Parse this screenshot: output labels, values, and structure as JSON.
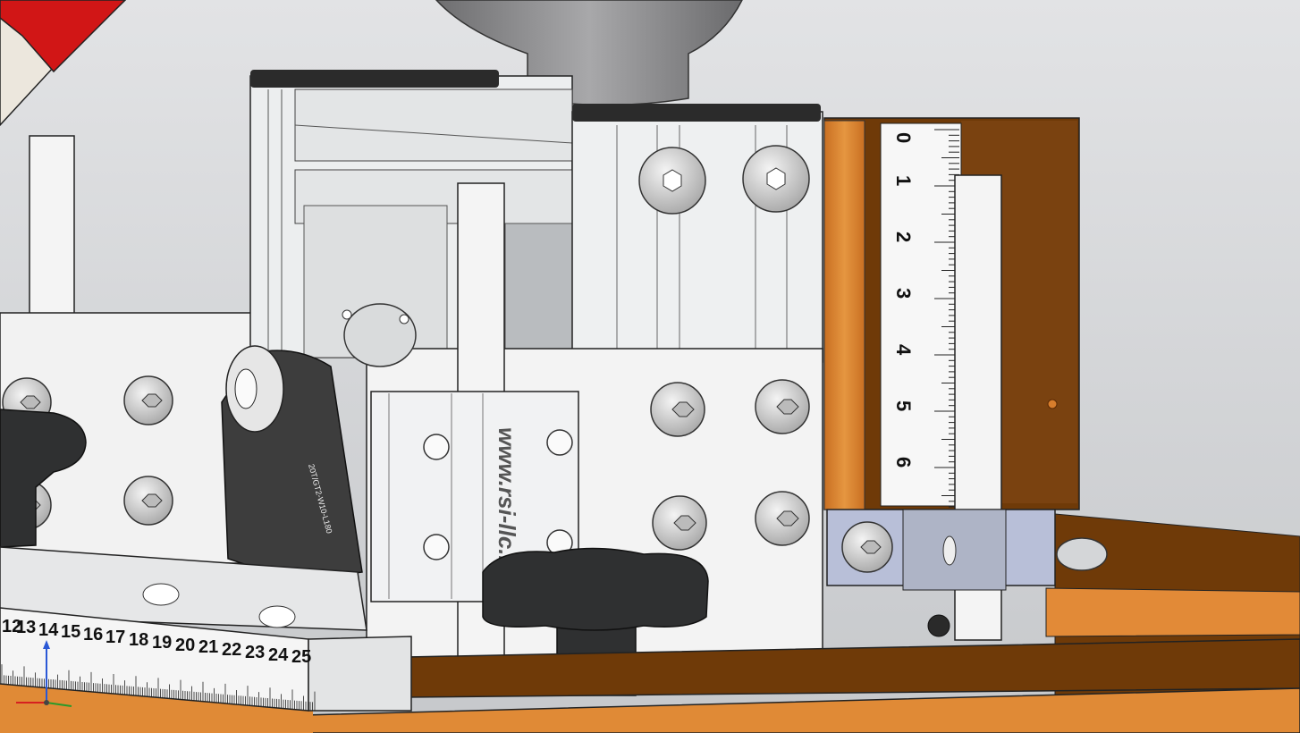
{
  "colors": {
    "background_top": "#e2e3e5",
    "background_bottom": "#c6c8cb",
    "aluminum": "#eceeef",
    "wood": "#d77d2c",
    "wood_dark": "#6f3a08",
    "knob": "#2f3031",
    "belt": "#3d3d3d",
    "red_part": "#d11616",
    "bracket_blue": "#b8bfd8"
  },
  "vertical_scale": {
    "numbers": [
      "0",
      "1",
      "2",
      "3",
      "4",
      "5",
      "6"
    ]
  },
  "bottom_ruler": {
    "numbers": [
      "12",
      "13",
      "14",
      "15",
      "16",
      "17",
      "18",
      "19",
      "20",
      "21",
      "22",
      "23",
      "24",
      "25"
    ]
  },
  "block_engraving": "www.rsi-llc.ru",
  "belt_label": "20T/GT2-W10-L180",
  "axis_triad": {
    "x_color": "#d62020",
    "y_color": "#2a9a2a",
    "z_color": "#2a58d6"
  }
}
